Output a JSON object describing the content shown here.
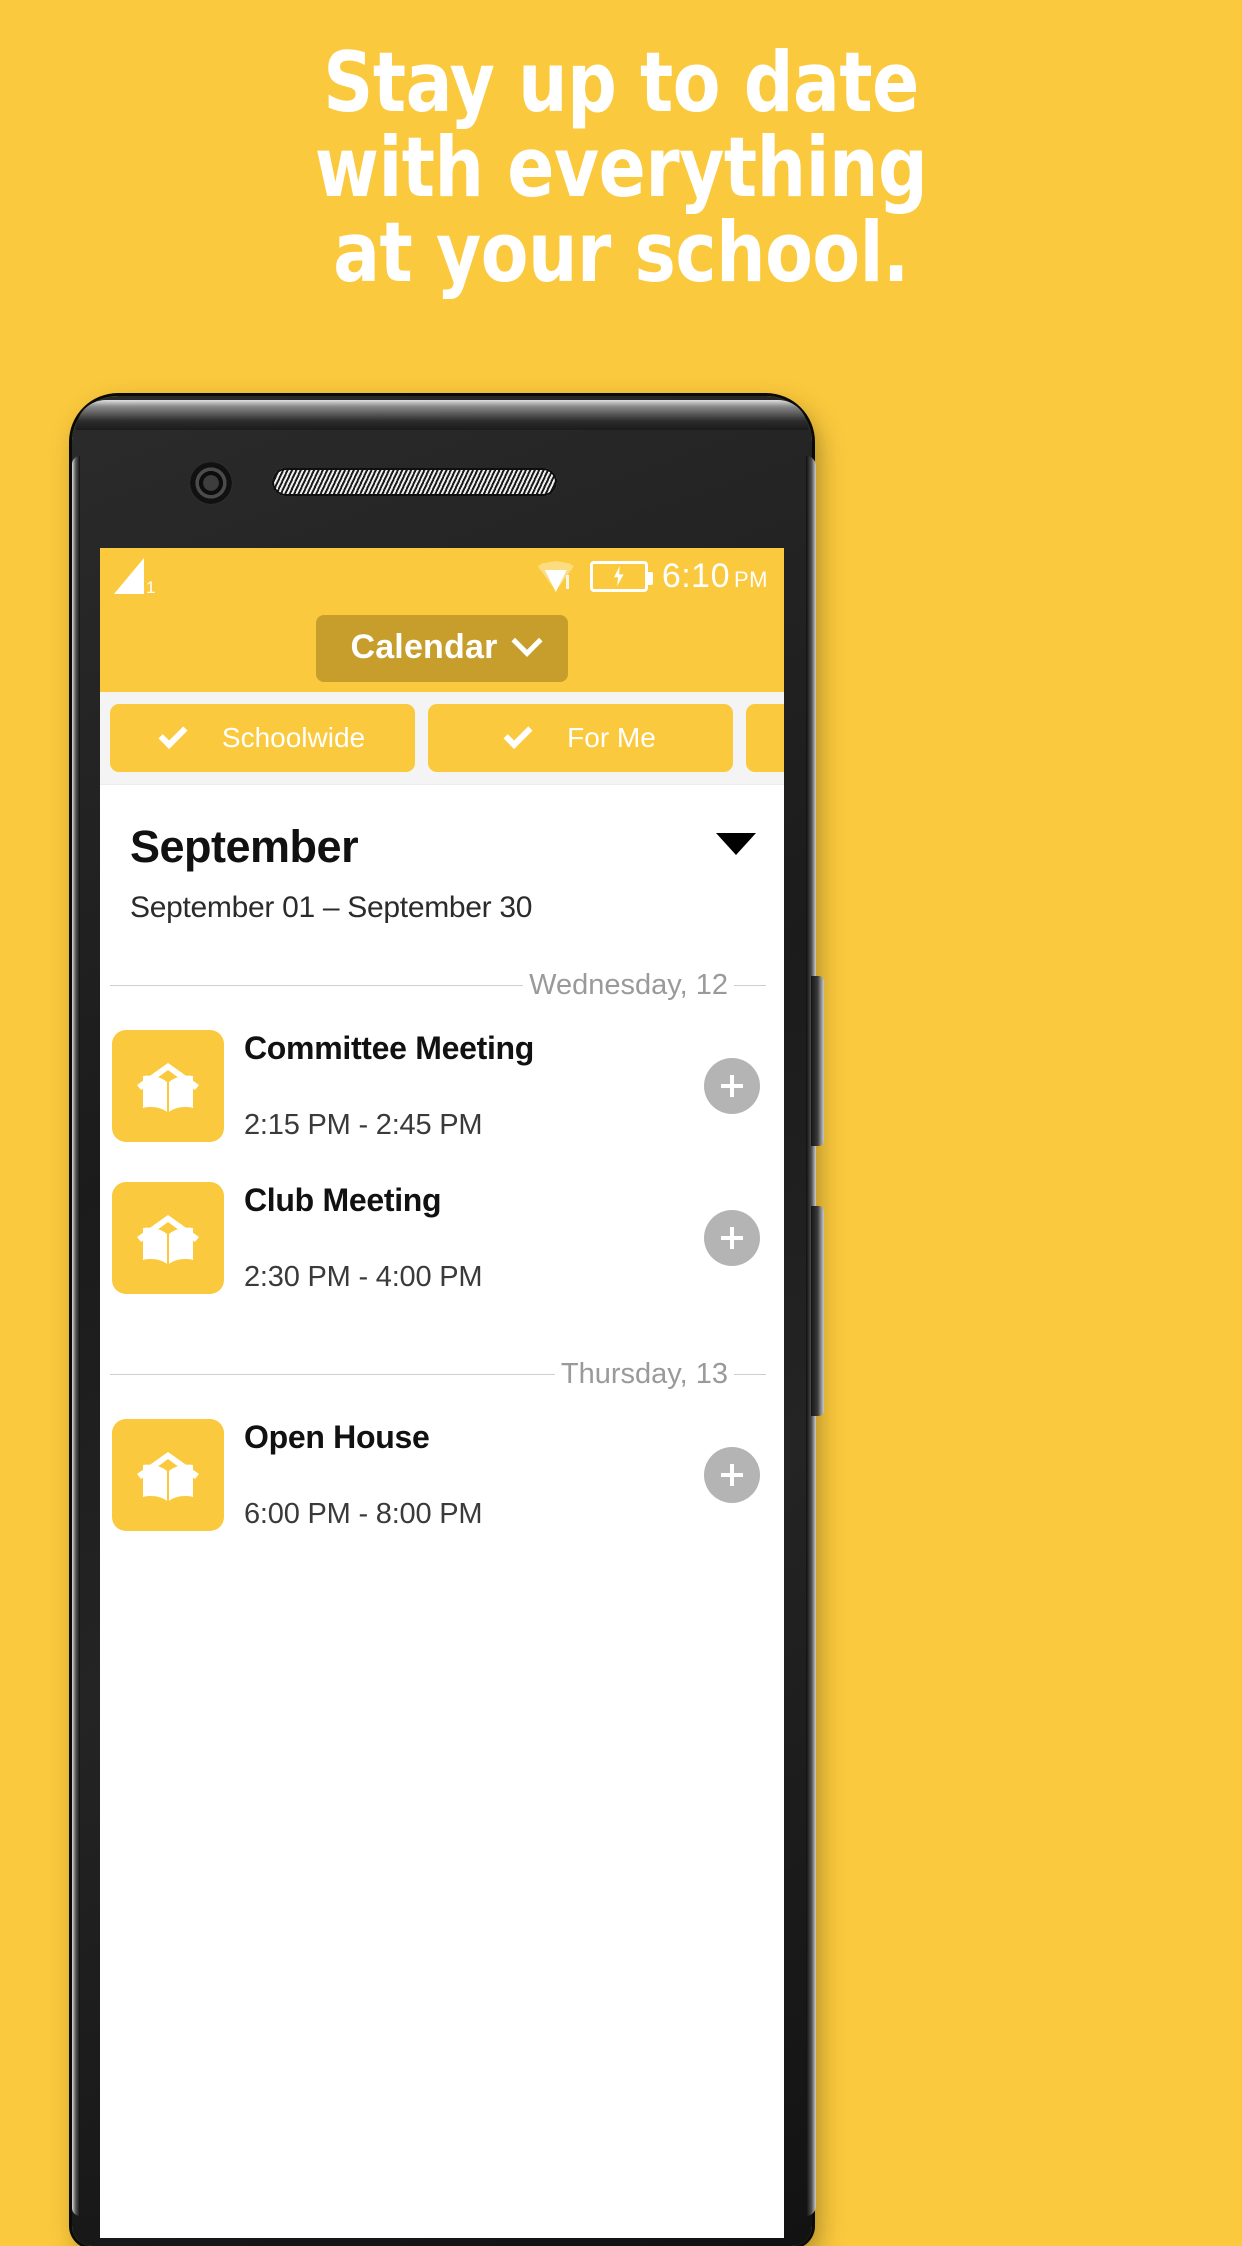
{
  "marketing": {
    "headline_lines": [
      "Stay up to date",
      "with everything",
      "at your school."
    ],
    "background_color": "#FBC93D",
    "headline_color": "#FFFFFF"
  },
  "phone": {
    "device_color": "#1b1b1b",
    "camera_icon": "front-camera",
    "speaker_icon": "earpiece-speaker"
  },
  "status_bar": {
    "signal_label": "1",
    "signal_icon": "cellular-signal-icon",
    "wifi_icon": "wifi-icon",
    "battery_icon": "battery-charging-icon",
    "time": "6:10",
    "ampm": "PM"
  },
  "appbar": {
    "title": "Calendar",
    "chevron_icon": "chevron-down-icon",
    "background": "#FBC93D",
    "button_background": "#C79E2B"
  },
  "filters": {
    "chips": [
      {
        "label": "Schoolwide",
        "checked": true,
        "check_icon": "check-icon"
      },
      {
        "label": "For Me",
        "checked": true,
        "check_icon": "check-icon"
      },
      {
        "label": "",
        "checked": false,
        "check_icon": "check-icon"
      }
    ]
  },
  "month": {
    "title": "September",
    "range": "September 01 – September 30",
    "caret_icon": "triangle-down-icon"
  },
  "days": [
    {
      "separator": "Wednesday, 12",
      "events": [
        {
          "title": "Committee Meeting",
          "time": "2:15 PM - 2:45 PM",
          "icon": "school-book-icon",
          "add_icon": "plus-icon"
        },
        {
          "title": "Club Meeting",
          "time": "2:30 PM - 4:00 PM",
          "icon": "school-book-icon",
          "add_icon": "plus-icon"
        }
      ]
    },
    {
      "separator": "Thursday, 13",
      "events": [
        {
          "title": "Open House",
          "time": "6:00 PM - 8:00 PM",
          "icon": "school-book-icon",
          "add_icon": "plus-icon"
        }
      ]
    }
  ],
  "colors": {
    "brand_yellow": "#FBC93D",
    "dark_gold": "#C79E2B",
    "text_dark": "#111111",
    "muted_gray": "#9A9A9A",
    "add_button_gray": "#B4B4B4"
  }
}
